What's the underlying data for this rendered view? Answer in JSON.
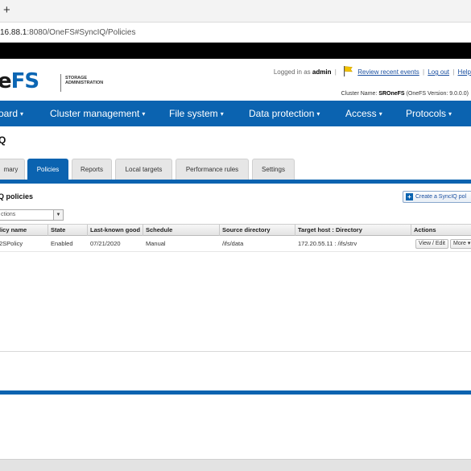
{
  "browser": {
    "new_tab": "+",
    "url_host": "16.88.1",
    "url_rest": ":8080/OneFS#SyncIQ/Policies"
  },
  "header": {
    "logo_prefix": "e",
    "logo_fs": "FS",
    "logo_sub_1": "STORAGE",
    "logo_sub_2": "ADMINISTRATION",
    "logged_in_prefix": "Logged in as",
    "user": "admin",
    "review_link": "Review recent events",
    "logout_link": "Log out",
    "help_link": "Help",
    "cluster_prefix": "Cluster Name:",
    "cluster_name": "SROneFS",
    "version": "(OneFS Version: 9.0.0.0)"
  },
  "nav": {
    "items": [
      {
        "label": "oard"
      },
      {
        "label": "Cluster management"
      },
      {
        "label": "File system"
      },
      {
        "label": "Data protection"
      },
      {
        "label": "Access"
      },
      {
        "label": "Protocols"
      }
    ]
  },
  "page": {
    "title": "Q",
    "tabs": [
      "mary",
      "Policies",
      "Reports",
      "Local targets",
      "Performance rules",
      "Settings"
    ],
    "active_tab": "Policies",
    "section_title": "Q policies",
    "create_button": "Create a SyncIQ pol",
    "actions_select": "ctions"
  },
  "table": {
    "columns": [
      "licy name",
      "State",
      "Last-known good",
      "Schedule",
      "Source directory",
      "Target host : Directory",
      "Actions"
    ],
    "rows": [
      {
        "name": "2SPolicy",
        "state": "Enabled",
        "last_good": "07/21/2020",
        "schedule": "Manual",
        "source": "/ifs/data",
        "target": "172.20.55.11 : /ifs/strv",
        "view_edit": "View / Edit",
        "more": "More"
      }
    ]
  },
  "colors": {
    "brand_blue": "#0b63b0",
    "flag_yellow": "#f2c200"
  }
}
